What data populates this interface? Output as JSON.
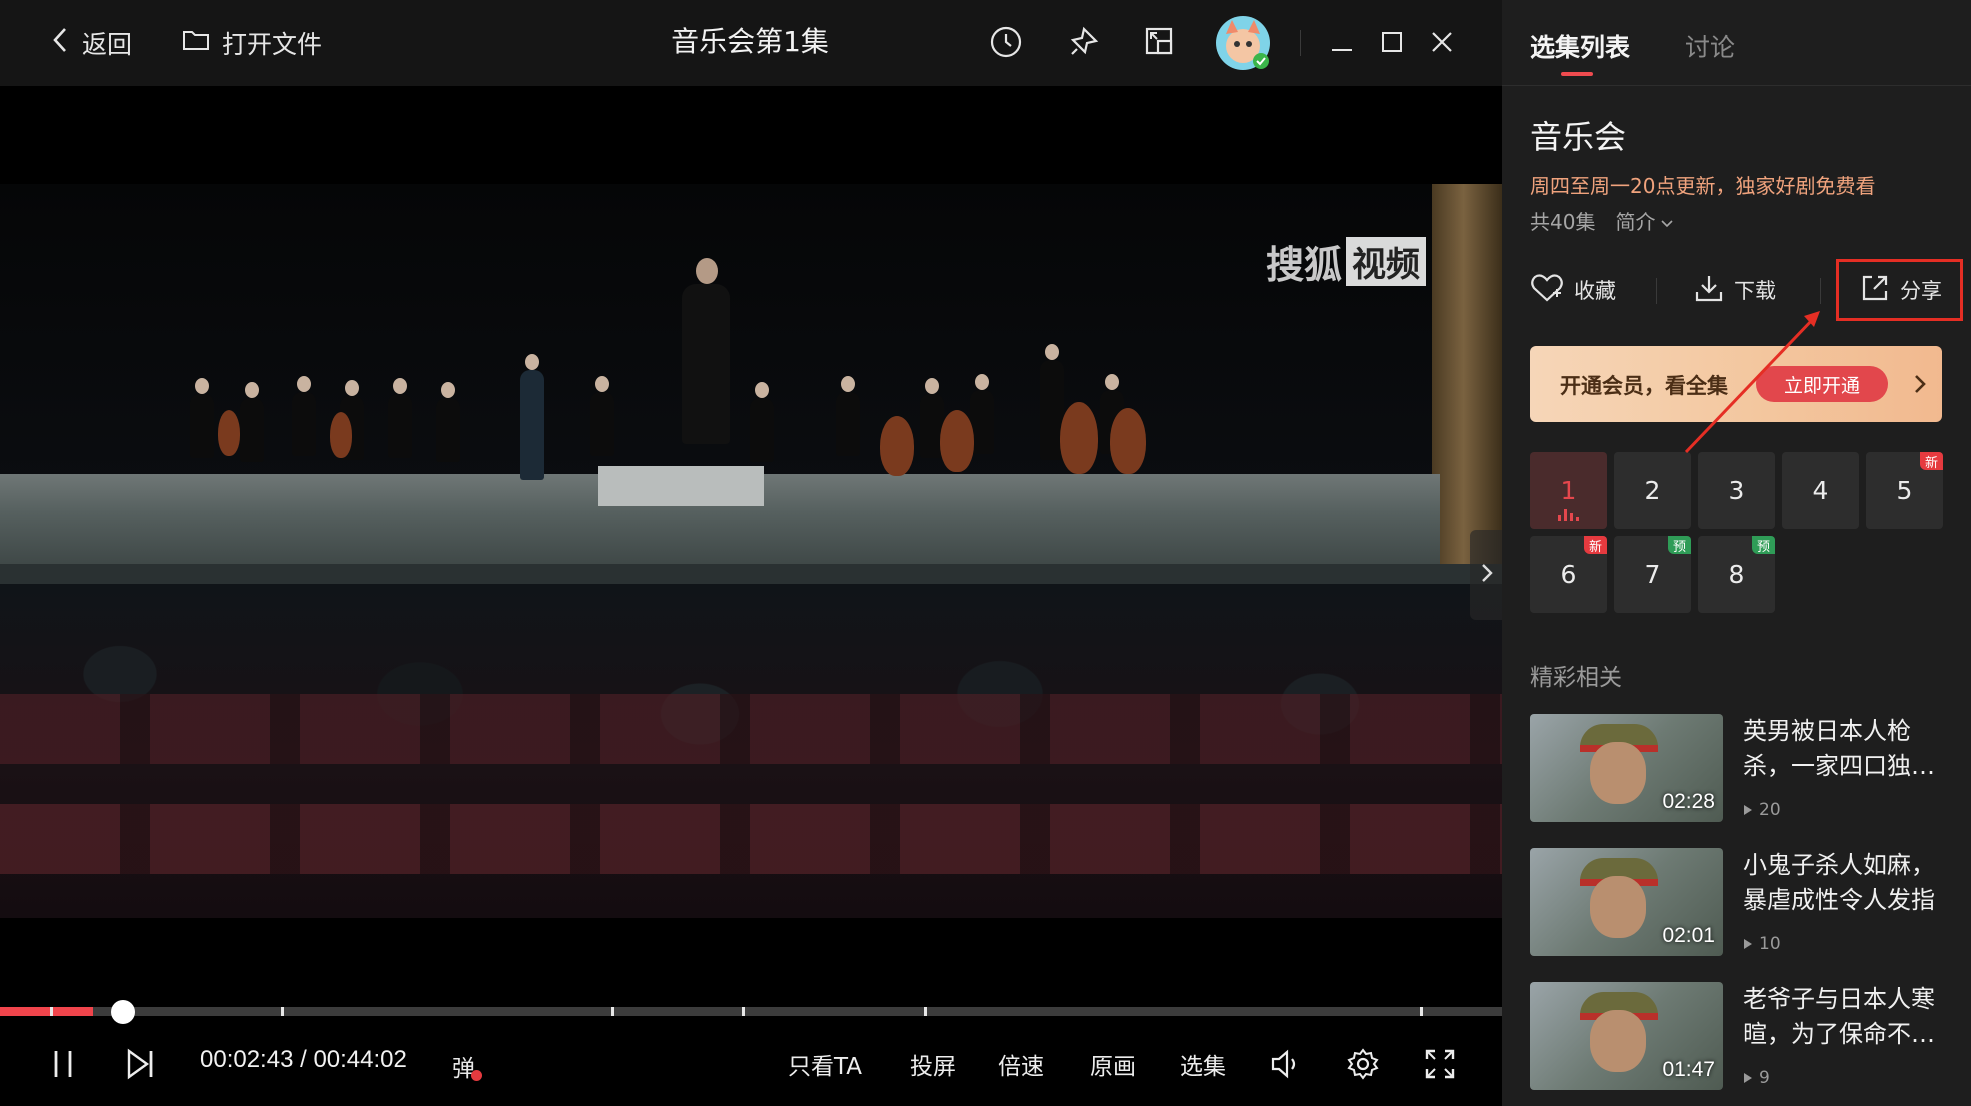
{
  "topbar": {
    "back_label": "返回",
    "open_file_label": "打开文件",
    "title": "音乐会第1集"
  },
  "video": {
    "watermark_text": "搜狐",
    "watermark_box": "视频"
  },
  "player": {
    "progress_fraction": 0.062,
    "current_time": "00:02:43",
    "separator": "/",
    "total_time": "00:44:02",
    "danmaku_label": "弹",
    "controls": [
      "只看TA",
      "投屏",
      "倍速",
      "原画",
      "选集"
    ]
  },
  "sidebar": {
    "tabs": [
      "选集列表",
      "讨论"
    ],
    "show_title": "音乐会",
    "update_text": "周四至周一20点更新，独家好剧免费看",
    "episode_count": "共40集",
    "intro_label": "简介",
    "actions": {
      "favorite": "收藏",
      "download": "下载",
      "share": "分享"
    },
    "vip": {
      "text": "开通会员，看全集",
      "button": "立即开通"
    },
    "episodes": [
      {
        "num": "1",
        "badge": ""
      },
      {
        "num": "2",
        "badge": ""
      },
      {
        "num": "3",
        "badge": ""
      },
      {
        "num": "4",
        "badge": ""
      },
      {
        "num": "5",
        "badge": "新"
      },
      {
        "num": "6",
        "badge": "新"
      },
      {
        "num": "7",
        "badge": "预"
      },
      {
        "num": "8",
        "badge": "预"
      }
    ],
    "related_title": "精彩相关",
    "related": [
      {
        "title": "英男被日本人枪杀，一家四口独…",
        "duration": "02:28",
        "plays": "20"
      },
      {
        "title": "小鬼子杀人如麻，暴虐成性令人发指",
        "duration": "02:01",
        "plays": "10"
      },
      {
        "title": "老爷子与日本人寒暄，为了保命不…",
        "duration": "01:47",
        "plays": "9"
      }
    ]
  },
  "colors": {
    "accent": "#ef4b4f",
    "update_text": "#f0a37d",
    "highlight_box": "#e52e24"
  }
}
